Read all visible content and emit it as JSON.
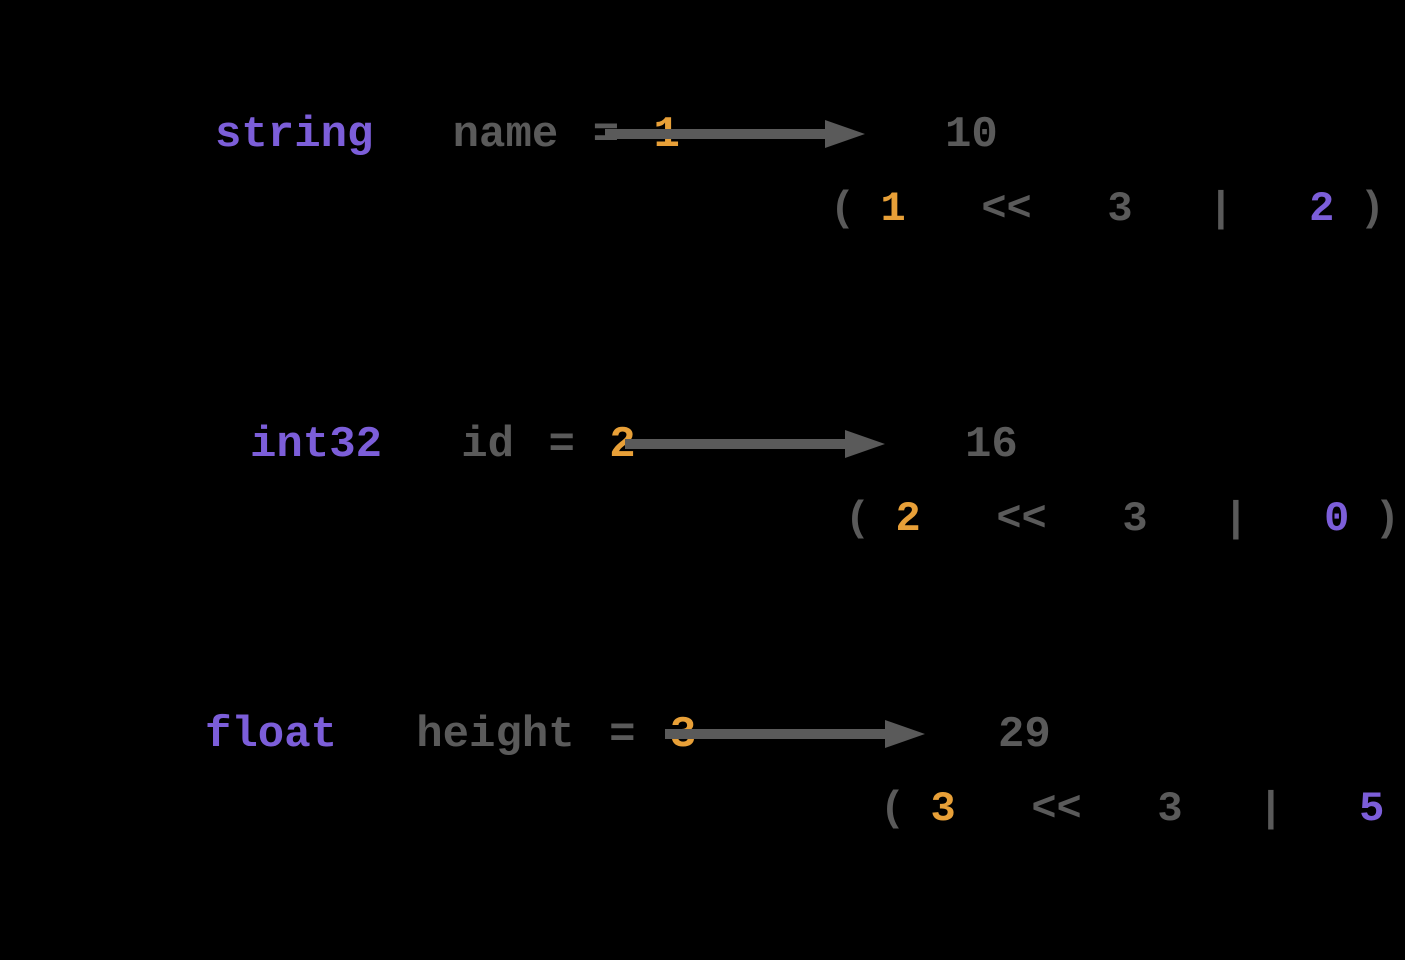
{
  "rows": [
    {
      "type": "string",
      "varname": "name",
      "eq": "=",
      "fieldnum": "1",
      "result": "10",
      "formula": {
        "open": "(",
        "a": "1",
        "shift": "<<",
        "b": "3",
        "pipe": "|",
        "c": "2",
        "close": ")"
      }
    },
    {
      "type": "int32",
      "varname": "id",
      "eq": "=",
      "fieldnum": "2",
      "result": "16",
      "formula": {
        "open": "(",
        "a": "2",
        "shift": "<<",
        "b": "3",
        "pipe": "|",
        "c": "0",
        "close": ")"
      }
    },
    {
      "type": "float",
      "varname": "height",
      "eq": "=",
      "fieldnum": "3",
      "result": "29",
      "formula": {
        "open": "(",
        "a": "3",
        "shift": "<<",
        "b": "3",
        "pipe": "|",
        "c": "5",
        "close": ")"
      }
    }
  ]
}
